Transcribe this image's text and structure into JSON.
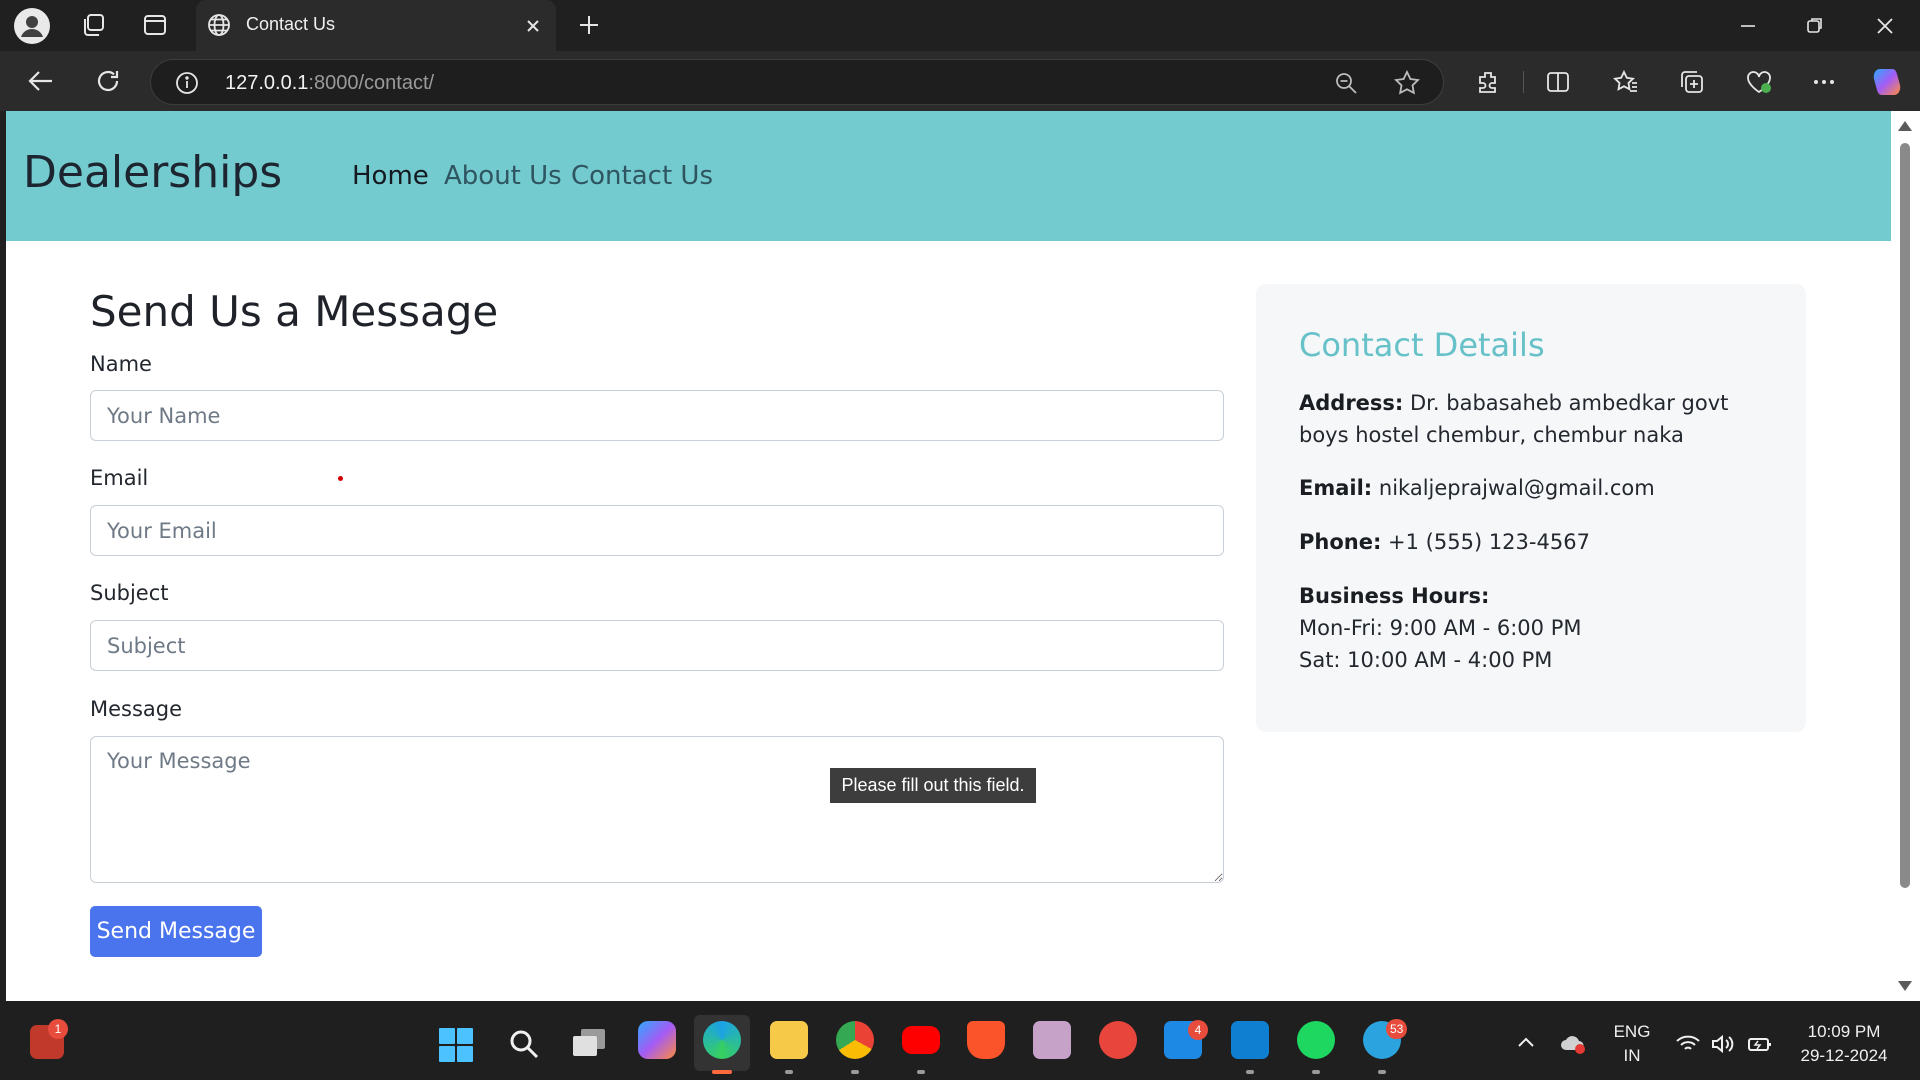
{
  "browser": {
    "tab_title": "Contact Us",
    "url_host": "127.0.0.1",
    "url_rest": ":8000/contact/"
  },
  "navbar": {
    "brand": "Dealerships",
    "links": [
      {
        "label": "Home",
        "active": true
      },
      {
        "label": "About Us",
        "active": false
      },
      {
        "label": "Contact Us",
        "active": false
      }
    ]
  },
  "form": {
    "title": "Send Us a Message",
    "name_label": "Name",
    "name_placeholder": "Your Name",
    "email_label": "Email",
    "email_placeholder": "Your Email",
    "subject_label": "Subject",
    "subject_placeholder": "Subject",
    "message_label": "Message",
    "message_placeholder": "Your Message",
    "submit_label": "Send Message",
    "validation_tooltip": "Please fill out this field."
  },
  "contact_details": {
    "title": "Contact Details",
    "address_label": "Address:",
    "address_value": "Dr. babasaheb ambedkar govt boys hostel chembur, chembur naka",
    "email_label": "Email:",
    "email_value": "nikaljeprajwal@gmail.com",
    "phone_label": "Phone:",
    "phone_value": "+1 (555) 123-4567",
    "hours_label": "Business Hours:",
    "hours_weekday": "Mon-Fri: 9:00 AM - 6:00 PM",
    "hours_saturday": "Sat: 10:00 AM - 4:00 PM"
  },
  "taskbar": {
    "notification_badge": "1",
    "wps_badge": "4",
    "telegram_badge": "53",
    "language_top": "ENG",
    "language_bottom": "IN",
    "time": "10:09 PM",
    "date": "29-12-2024"
  },
  "colors": {
    "navbar_bg": "#73cbcf",
    "accent_teal": "#66c2c8",
    "submit_blue": "#4a73ee"
  }
}
